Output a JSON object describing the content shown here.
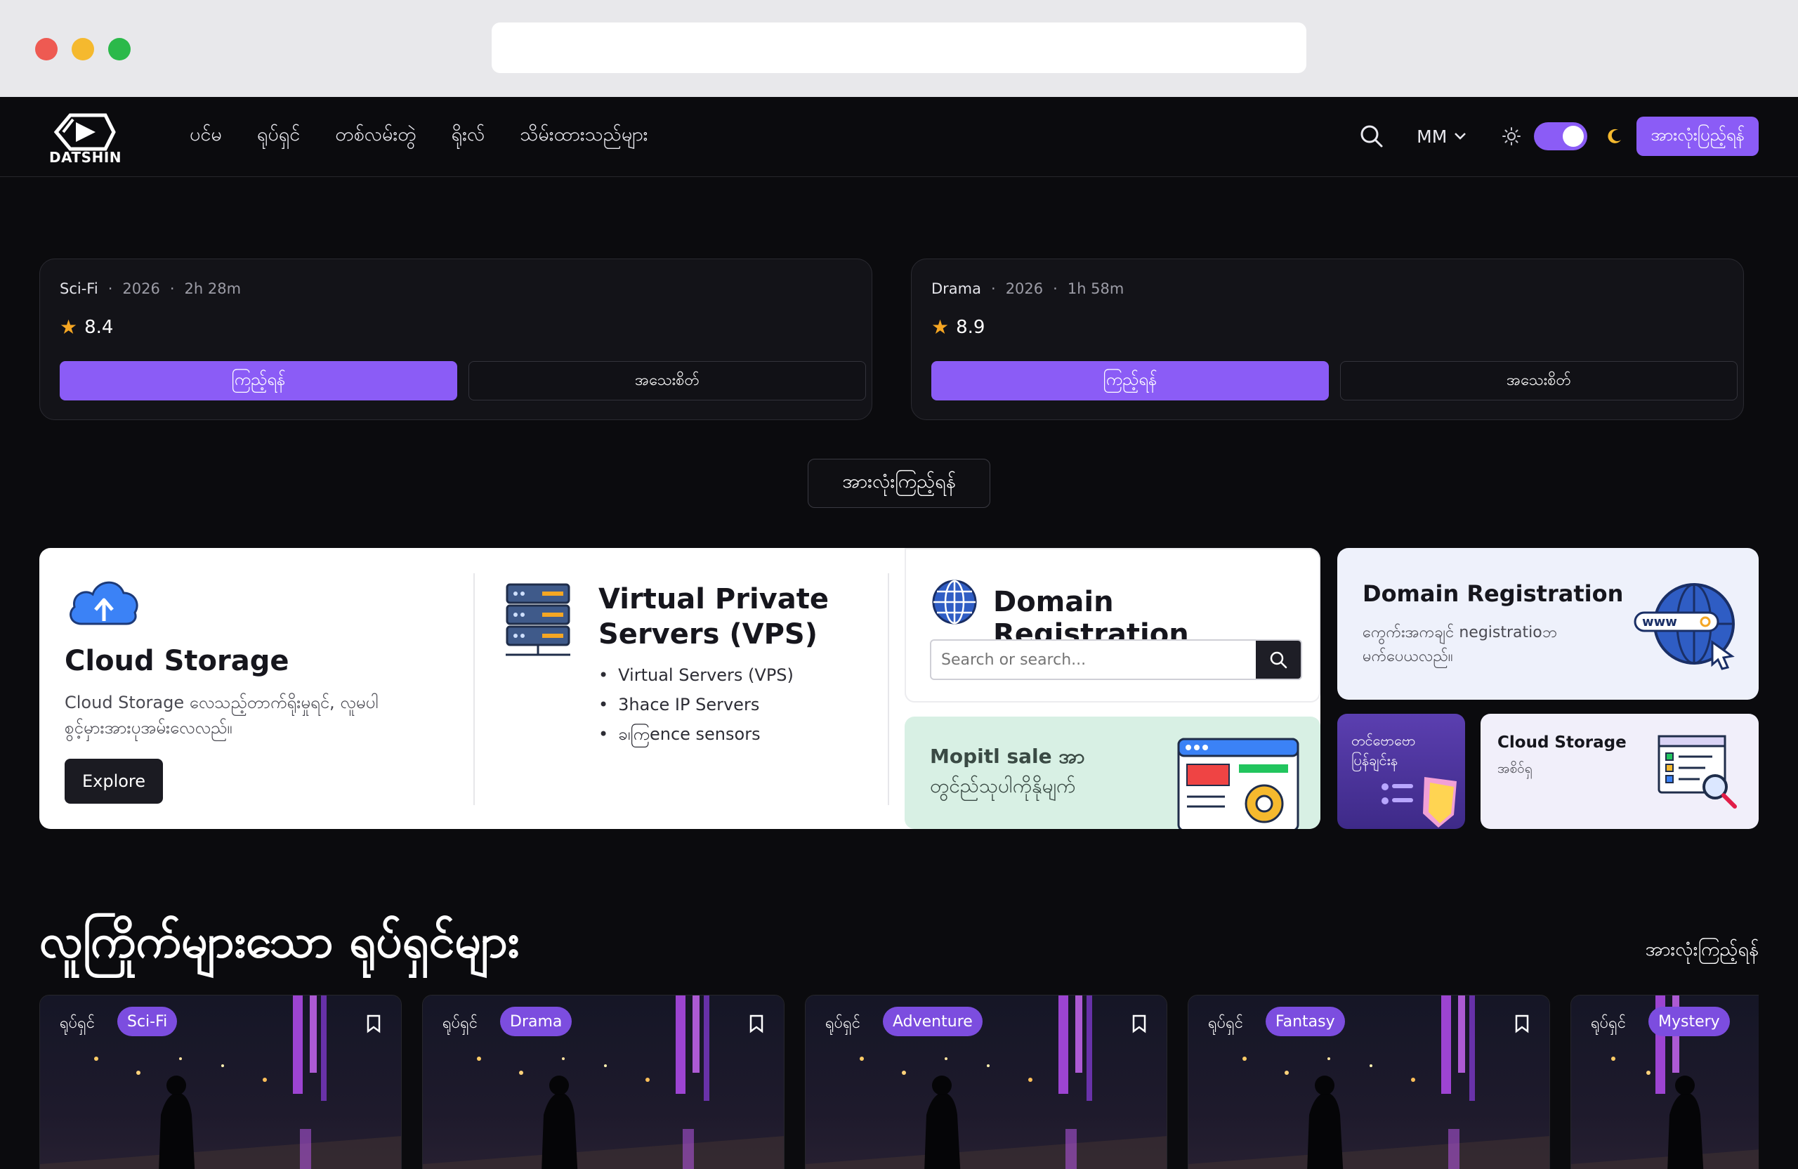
{
  "nav": {
    "logo_text": "DATSHIN",
    "links": [
      "ပင်မ",
      "ရုပ်ရှင်",
      "တစ်လမ်းတွဲ",
      "ရိုးလ်",
      "သိမ်းထားသည်များ"
    ],
    "language": "MM",
    "watch_all_button": "အားလုံးပြည့်ရန်",
    "accent": "#8b5cf6"
  },
  "featured": [
    {
      "genre": "Sci-Fi",
      "year": "2026",
      "duration": "2h 28m",
      "rating": "8.4",
      "watch_label": "ကြည့်ရန်",
      "detail_label": "အသေးစိတ်"
    },
    {
      "genre": "Drama",
      "year": "2026",
      "duration": "1h 58m",
      "rating": "8.9",
      "watch_label": "ကြည့်ရန်",
      "detail_label": "အသေးစိတ်"
    }
  ],
  "view_all_center": "အားလုံးကြည့်ရန်",
  "ad": {
    "cloud": {
      "title": "Cloud Storage",
      "desc": "Cloud Storage လေသည့်တာက်ရိုးမှုရင်, လူမပါစွင့်မှားအားပုအမ်းလေလည်။",
      "explore": "Explore"
    },
    "vps": {
      "title": "Virtual Private Servers (VPS)",
      "items": [
        "Virtual Servers (VPS)",
        "3hace IP Servers",
        "ခ၊ကြence sensors"
      ]
    },
    "domain": {
      "title": "Domain Registration",
      "search_placeholder": "Search or search..."
    },
    "mopit": {
      "text_line1": "Mopitl sale အာ",
      "text_line2": "တွင်ည်သုပါကိုနိုမျက်"
    },
    "domain2": {
      "title": "Domain Registration",
      "desc": "ကွေက်းအကချင် negistratioဘ မက်ပေယလည်။",
      "www": "www"
    },
    "purple": {
      "line1": "တင်ဗောဗော",
      "line2": "ပြန်ချင်းန"
    },
    "cloud2": {
      "title": "Cloud Storage",
      "desc": "အစိဝ်ရှ"
    }
  },
  "section": {
    "title": "လူကြိုက်များသော ရုပ်ရှင်များ",
    "view_all": "အားလုံးကြည့်ရန်",
    "posters": [
      {
        "kind": "ရုပ်ရှင်",
        "tag": "Sci-Fi"
      },
      {
        "kind": "ရုပ်ရှင်",
        "tag": "Drama"
      },
      {
        "kind": "ရုပ်ရှင်",
        "tag": "Adventure"
      },
      {
        "kind": "ရုပ်ရှင်",
        "tag": "Fantasy"
      },
      {
        "kind": "ရုပ်ရှင်",
        "tag": "Mystery"
      }
    ]
  }
}
